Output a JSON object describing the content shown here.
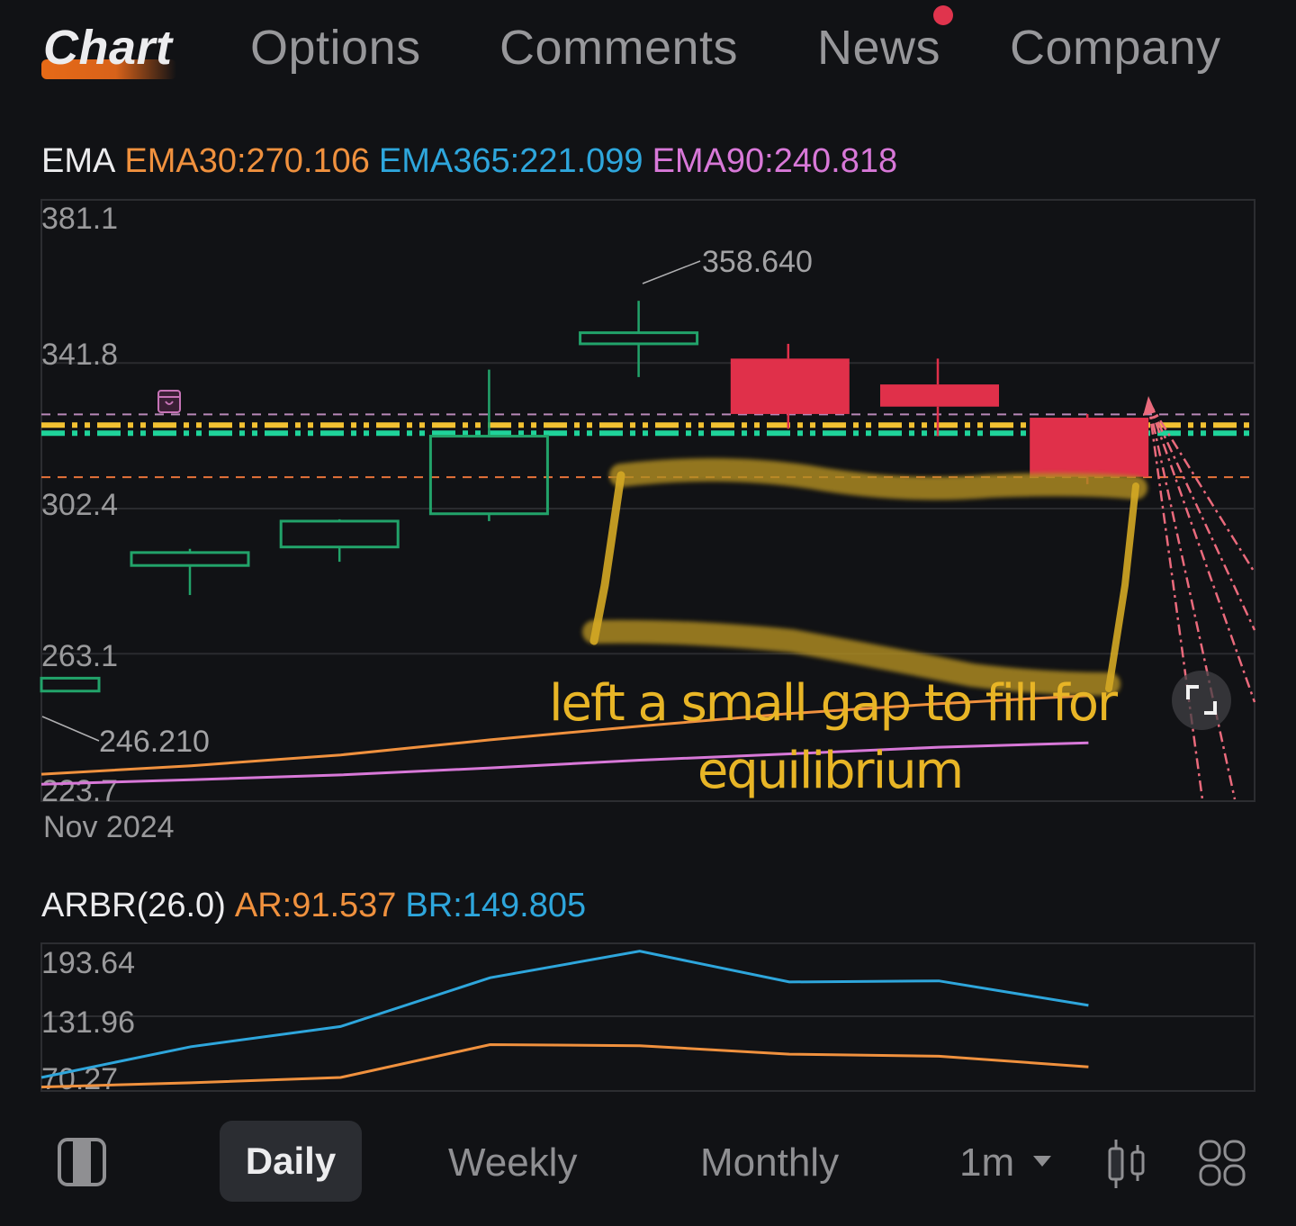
{
  "tabs": [
    {
      "label": "Chart",
      "active": true
    },
    {
      "label": "Options",
      "active": false
    },
    {
      "label": "Comments",
      "active": false
    },
    {
      "label": "News",
      "active": false,
      "badge": "notification-dot"
    },
    {
      "label": "Company",
      "active": false
    }
  ],
  "ema_legend": {
    "title": "EMA",
    "ema30": "EMA30:270.106",
    "ema365": "EMA365:221.099",
    "ema90": "EMA90:240.818"
  },
  "arbr_legend": {
    "title": "ARBR(26.0)",
    "ar": "AR:91.537",
    "br": "BR:149.805"
  },
  "colors": {
    "background": "#111215",
    "up": "#22a36a",
    "down": "#e0304a",
    "ema30": "#f0913e",
    "ema365": "#2ea6dc",
    "ema90": "#d878d8",
    "annotation": "#e8b526",
    "fan_lines": "#ea6a7c",
    "level_yellow": "#f3c132",
    "level_green": "#1fd39a",
    "level_pink_dashed": "#b888b8",
    "level_orange_dashed": "#e8733a"
  },
  "bottom_bar": {
    "daily": "Daily",
    "weekly": "Weekly",
    "monthly": "Monthly",
    "interval": "1m",
    "icons": [
      "panel-toggle-icon",
      "candlestick-icon",
      "grid-icon"
    ]
  },
  "chart_data": [
    {
      "type": "candlestick",
      "title": "EMA",
      "xlabel": "Nov 2024",
      "y_ticks": [
        "381.1",
        "341.8",
        "302.4",
        "263.1",
        "223.7"
      ],
      "ylim": [
        223.7,
        381.1
      ],
      "grid": true,
      "candles": [
        {
          "open": 287.0,
          "close": 290.5,
          "high": 291.5,
          "low": 279.0
        },
        {
          "open": 292.0,
          "close": 299.0,
          "high": 299.5,
          "low": 288.0
        },
        {
          "open": 301.0,
          "close": 322.0,
          "high": 340.0,
          "low": 299.0
        },
        {
          "open": 347.0,
          "close": 350.0,
          "high": 358.64,
          "low": 338.0
        },
        {
          "open": 343.0,
          "close": 328.0,
          "high": 347.0,
          "low": 324.0
        },
        {
          "open": 336.0,
          "close": 330.0,
          "high": 343.0,
          "low": 322.0
        },
        {
          "open": 327.0,
          "close": 311.0,
          "high": 328.0,
          "low": 309.0
        }
      ],
      "partial_prior_candle": {
        "open": 253.0,
        "close": 256.5
      },
      "annotations_text": {
        "max_label": "358.640",
        "min_label": "246.210"
      },
      "series": [
        {
          "name": "EMA30",
          "values": [
            230.5,
            232.8,
            235.7,
            239.8,
            243.5,
            246.9,
            249.6,
            251.8
          ]
        },
        {
          "name": "EMA90",
          "values": [
            227.8,
            229.0,
            230.3,
            232.2,
            234.3,
            236.0,
            237.8,
            239.0
          ]
        }
      ],
      "horizontal_levels": [
        {
          "name": "pink-dashed",
          "value": 327.9,
          "style": "dashed"
        },
        {
          "name": "yellow-dashdot",
          "value": 325.0,
          "style": "dash-dot"
        },
        {
          "name": "green-dashdot",
          "value": 322.8,
          "style": "dash-dot"
        },
        {
          "name": "orange-dashed",
          "value": 310.9,
          "style": "dashed"
        }
      ],
      "handwritten_note": [
        "left a small gap to fill for",
        "equilibrium"
      ]
    },
    {
      "type": "line",
      "title": "ARBR(26.0)",
      "y_ticks": [
        "193.64",
        "131.96",
        "70.27"
      ],
      "ylim": [
        63.0,
        197.0
      ],
      "grid": true,
      "series": [
        {
          "name": "BR",
          "values": [
            74.0,
            103.0,
            122.0,
            168.0,
            193.0,
            164.0,
            165.0,
            142.0
          ]
        },
        {
          "name": "AR",
          "values": [
            65.0,
            69.0,
            74.0,
            105.0,
            104.0,
            96.0,
            94.0,
            84.0
          ]
        }
      ]
    }
  ]
}
